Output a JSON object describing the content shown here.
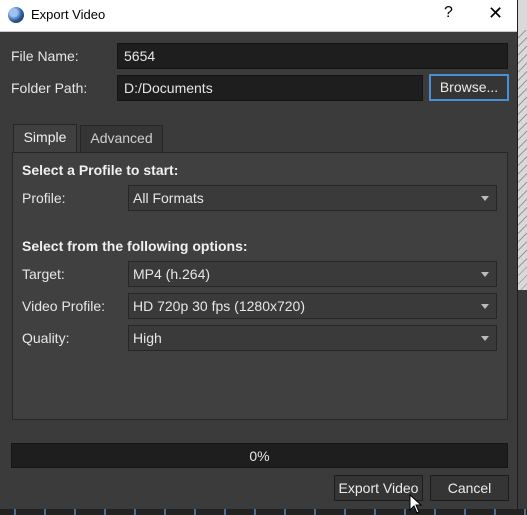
{
  "window": {
    "title": "Export Video",
    "help_glyph": "?",
    "close_glyph": "✕"
  },
  "form": {
    "file_name_label": "File Name:",
    "file_name_value": "5654",
    "folder_path_label": "Folder Path:",
    "folder_path_value": "D:/Documents",
    "browse_label": "Browse..."
  },
  "tabs": [
    {
      "label": "Simple",
      "active": true
    },
    {
      "label": "Advanced",
      "active": false
    }
  ],
  "simple": {
    "profile_section_title": "Select a Profile to start:",
    "profile_label": "Profile:",
    "profile_value": "All Formats",
    "options_section_title": "Select from the following options:",
    "target_label": "Target:",
    "target_value": "MP4 (h.264)",
    "video_profile_label": "Video Profile:",
    "video_profile_value": "HD 720p 30 fps (1280x720)",
    "quality_label": "Quality:",
    "quality_value": "High"
  },
  "progress": {
    "fraction": 0,
    "text": "0%"
  },
  "actions": {
    "export_label": "Export Video",
    "cancel_label": "Cancel"
  },
  "colors": {
    "accent": "#4a8fd4",
    "progress_fill": "#3a7bc8",
    "dialog_bg": "#3b3b3b"
  },
  "icons": {
    "app": "openshot-app-icon",
    "dropdown": "chevron-down-icon",
    "close": "close-icon",
    "help": "help-icon",
    "cursor": "mouse-pointer-icon"
  }
}
